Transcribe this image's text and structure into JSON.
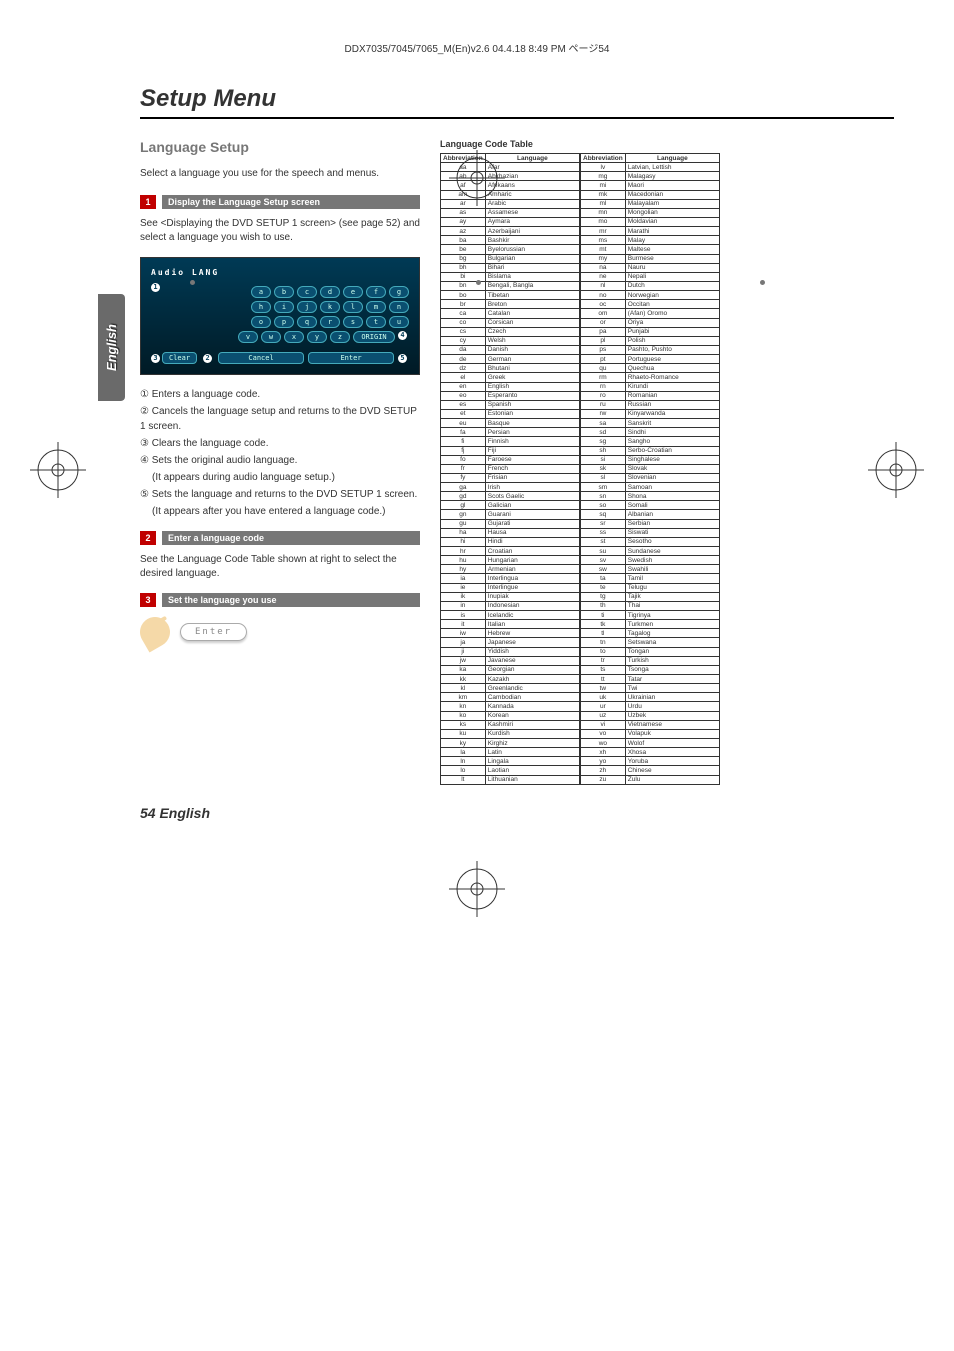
{
  "header_line": "DDX7035/7045/7065_M(En)v2.6  04.4.18  8:49 PM  ページ54",
  "setup_title": "Setup Menu",
  "side_tab": "English",
  "section_title": "Language Setup",
  "intro": "Select a language you use for the speech and menus.",
  "step1": {
    "num": "1",
    "label": "Display the Language Setup screen"
  },
  "step1_body": "See <Displaying the DVD SETUP 1 screen> (see page 52) and select a language you wish to use.",
  "screen": {
    "head": "Audio  LANG",
    "rowA": [
      "a",
      "b",
      "c",
      "d",
      "e",
      "f",
      "g"
    ],
    "rowB": [
      "h",
      "i",
      "j",
      "k",
      "l",
      "m",
      "n"
    ],
    "rowC": [
      "o",
      "p",
      "q",
      "r",
      "s",
      "t",
      "u"
    ],
    "rowD": [
      "v",
      "w",
      "x",
      "y",
      "z"
    ],
    "origin": "ORIGIN",
    "clear": "Clear",
    "cancel": "Cancel",
    "enter": "Enter",
    "c1": "1",
    "c2": "2",
    "c3": "3",
    "c4": "4",
    "c5": "5"
  },
  "notes": {
    "n1": "① Enters a language code.",
    "n2": "② Cancels the language setup and returns to the DVD SETUP 1 screen.",
    "n3": "③ Clears the language code.",
    "n4": "④ Sets the original audio language.",
    "n4b": "(It appears during audio language setup.)",
    "n5": "⑤ Sets the language and returns to the DVD SETUP 1 screen.",
    "n5b": "(It appears after you have entered a language code.)"
  },
  "step2": {
    "num": "2",
    "label": "Enter a language code"
  },
  "step2_body": "See the Language Code Table shown at right to select the desired language.",
  "step3": {
    "num": "3",
    "label": "Set the language you use"
  },
  "enter_label": "Enter",
  "table_title": "Language Code Table",
  "headers": {
    "abbr": "Abbreviation",
    "lang": "Language"
  },
  "codes_left": [
    [
      "aa",
      "Afar"
    ],
    [
      "ab",
      "Abkhazian"
    ],
    [
      "af",
      "Afrikaans"
    ],
    [
      "am",
      "Amharic"
    ],
    [
      "ar",
      "Arabic"
    ],
    [
      "as",
      "Assamese"
    ],
    [
      "ay",
      "Aymara"
    ],
    [
      "az",
      "Azerbaijani"
    ],
    [
      "ba",
      "Bashkir"
    ],
    [
      "be",
      "Byelorussian"
    ],
    [
      "bg",
      "Bulgarian"
    ],
    [
      "bh",
      "Bihari"
    ],
    [
      "bi",
      "Bislama"
    ],
    [
      "bn",
      "Bengali, Bangla"
    ],
    [
      "bo",
      "Tibetan"
    ],
    [
      "br",
      "Breton"
    ],
    [
      "ca",
      "Catalan"
    ],
    [
      "co",
      "Corsican"
    ],
    [
      "cs",
      "Czech"
    ],
    [
      "cy",
      "Welsh"
    ],
    [
      "da",
      "Danish"
    ],
    [
      "de",
      "German"
    ],
    [
      "dz",
      "Bhutani"
    ],
    [
      "el",
      "Greek"
    ],
    [
      "en",
      "English"
    ],
    [
      "eo",
      "Esperanto"
    ],
    [
      "es",
      "Spanish"
    ],
    [
      "et",
      "Estonian"
    ],
    [
      "eu",
      "Basque"
    ],
    [
      "fa",
      "Persian"
    ],
    [
      "fi",
      "Finnish"
    ],
    [
      "fj",
      "Fiji"
    ],
    [
      "fo",
      "Faroese"
    ],
    [
      "fr",
      "French"
    ],
    [
      "fy",
      "Frisian"
    ],
    [
      "ga",
      "Irish"
    ],
    [
      "gd",
      "Scots Gaelic"
    ],
    [
      "gl",
      "Galician"
    ],
    [
      "gn",
      "Guarani"
    ],
    [
      "gu",
      "Gujarati"
    ],
    [
      "ha",
      "Hausa"
    ],
    [
      "hi",
      "Hindi"
    ],
    [
      "hr",
      "Croatian"
    ],
    [
      "hu",
      "Hungarian"
    ],
    [
      "hy",
      "Armenian"
    ],
    [
      "ia",
      "Interlingua"
    ],
    [
      "ie",
      "Interlingue"
    ],
    [
      "ik",
      "Inupiak"
    ],
    [
      "in",
      "Indonesian"
    ],
    [
      "is",
      "Icelandic"
    ],
    [
      "it",
      "Italian"
    ],
    [
      "iw",
      "Hebrew"
    ],
    [
      "ja",
      "Japanese"
    ],
    [
      "ji",
      "Yiddish"
    ],
    [
      "jw",
      "Javanese"
    ],
    [
      "ka",
      "Georgian"
    ],
    [
      "kk",
      "Kazakh"
    ],
    [
      "kl",
      "Greenlandic"
    ],
    [
      "km",
      "Cambodian"
    ],
    [
      "kn",
      "Kannada"
    ],
    [
      "ko",
      "Korean"
    ],
    [
      "ks",
      "Kashmiri"
    ],
    [
      "ku",
      "Kurdish"
    ],
    [
      "ky",
      "Kirghiz"
    ],
    [
      "la",
      "Latin"
    ],
    [
      "ln",
      "Lingala"
    ],
    [
      "lo",
      "Laotian"
    ],
    [
      "lt",
      "Lithuanian"
    ]
  ],
  "codes_right": [
    [
      "lv",
      "Latvian, Lettish"
    ],
    [
      "mg",
      "Malagasy"
    ],
    [
      "mi",
      "Maori"
    ],
    [
      "mk",
      "Macedonian"
    ],
    [
      "ml",
      "Malayalam"
    ],
    [
      "mn",
      "Mongolian"
    ],
    [
      "mo",
      "Moldavian"
    ],
    [
      "mr",
      "Marathi"
    ],
    [
      "ms",
      "Malay"
    ],
    [
      "mt",
      "Maltese"
    ],
    [
      "my",
      "Burmese"
    ],
    [
      "na",
      "Nauru"
    ],
    [
      "ne",
      "Nepali"
    ],
    [
      "nl",
      "Dutch"
    ],
    [
      "no",
      "Norwegian"
    ],
    [
      "oc",
      "Occitan"
    ],
    [
      "om",
      "(Afan) Oromo"
    ],
    [
      "or",
      "Oriya"
    ],
    [
      "pa",
      "Punjabi"
    ],
    [
      "pl",
      "Polish"
    ],
    [
      "ps",
      "Pashto, Pushto"
    ],
    [
      "pt",
      "Portuguese"
    ],
    [
      "qu",
      "Quechua"
    ],
    [
      "rm",
      "Rhaeto-Romance"
    ],
    [
      "rn",
      "Kirundi"
    ],
    [
      "ro",
      "Romanian"
    ],
    [
      "ru",
      "Russian"
    ],
    [
      "rw",
      "Kinyarwanda"
    ],
    [
      "sa",
      "Sanskrit"
    ],
    [
      "sd",
      "Sindhi"
    ],
    [
      "sg",
      "Sangho"
    ],
    [
      "sh",
      "Serbo-Croatian"
    ],
    [
      "si",
      "Singhalese"
    ],
    [
      "sk",
      "Slovak"
    ],
    [
      "sl",
      "Slovenian"
    ],
    [
      "sm",
      "Samoan"
    ],
    [
      "sn",
      "Shona"
    ],
    [
      "so",
      "Somali"
    ],
    [
      "sq",
      "Albanian"
    ],
    [
      "sr",
      "Serbian"
    ],
    [
      "ss",
      "Siswati"
    ],
    [
      "st",
      "Sesotho"
    ],
    [
      "su",
      "Sundanese"
    ],
    [
      "sv",
      "Swedish"
    ],
    [
      "sw",
      "Swahili"
    ],
    [
      "ta",
      "Tamil"
    ],
    [
      "te",
      "Telugu"
    ],
    [
      "tg",
      "Tajik"
    ],
    [
      "th",
      "Thai"
    ],
    [
      "ti",
      "Tigrinya"
    ],
    [
      "tk",
      "Turkmen"
    ],
    [
      "tl",
      "Tagalog"
    ],
    [
      "tn",
      "Setswana"
    ],
    [
      "to",
      "Tongan"
    ],
    [
      "tr",
      "Turkish"
    ],
    [
      "ts",
      "Tsonga"
    ],
    [
      "tt",
      "Tatar"
    ],
    [
      "tw",
      "Twi"
    ],
    [
      "uk",
      "Ukrainian"
    ],
    [
      "ur",
      "Urdu"
    ],
    [
      "uz",
      "Uzbek"
    ],
    [
      "vi",
      "Vietnamese"
    ],
    [
      "vo",
      "Volapuk"
    ],
    [
      "wo",
      "Wolof"
    ],
    [
      "xh",
      "Xhosa"
    ],
    [
      "yo",
      "Yoruba"
    ],
    [
      "zh",
      "Chinese"
    ],
    [
      "zu",
      "Zulu"
    ]
  ],
  "footer": "54 English"
}
